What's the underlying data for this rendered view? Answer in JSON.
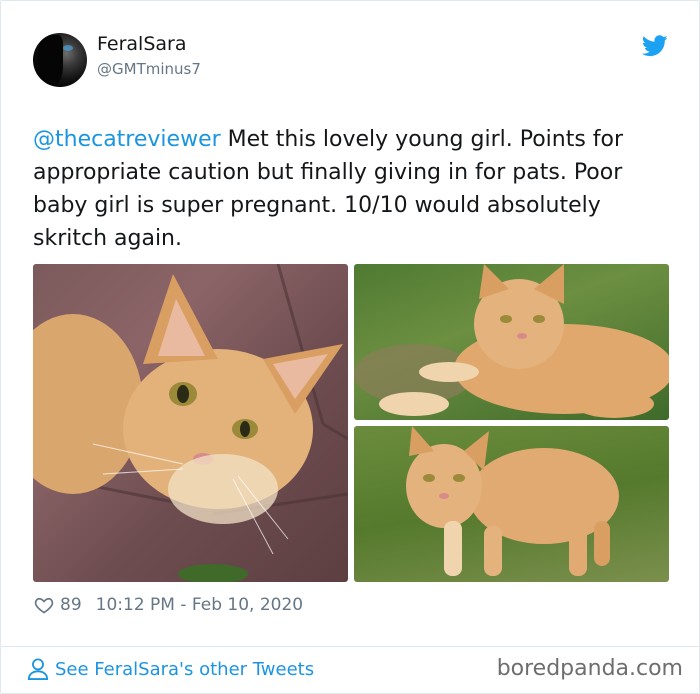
{
  "tweet": {
    "author": {
      "display_name": "FeralSara",
      "handle": "@GMTminus7"
    },
    "text": {
      "mention": "@thecatreviewer",
      "body": " Met this lovely young girl. Points for appropriate caution but finally giving in for pats. Poor baby girl is super pregnant. 10/10 would absolutely skritch again."
    },
    "media": [
      {
        "description": "orange tabby cat lying on a red brick, close-up of face"
      },
      {
        "description": "orange tabby cat lying in grass"
      },
      {
        "description": "orange tabby cat standing in grass"
      }
    ],
    "likes": "89",
    "timestamp": "10:12 PM - Feb 10, 2020"
  },
  "footer": {
    "link_label": "See FeralSara's other Tweets"
  },
  "watermark": "boredpanda.com",
  "colors": {
    "link": "#1b95e0",
    "muted": "#657786",
    "text": "#14171a",
    "twitter_blue": "#1da1f2"
  },
  "icons": [
    "twitter-bird-icon",
    "heart-icon",
    "person-icon"
  ]
}
